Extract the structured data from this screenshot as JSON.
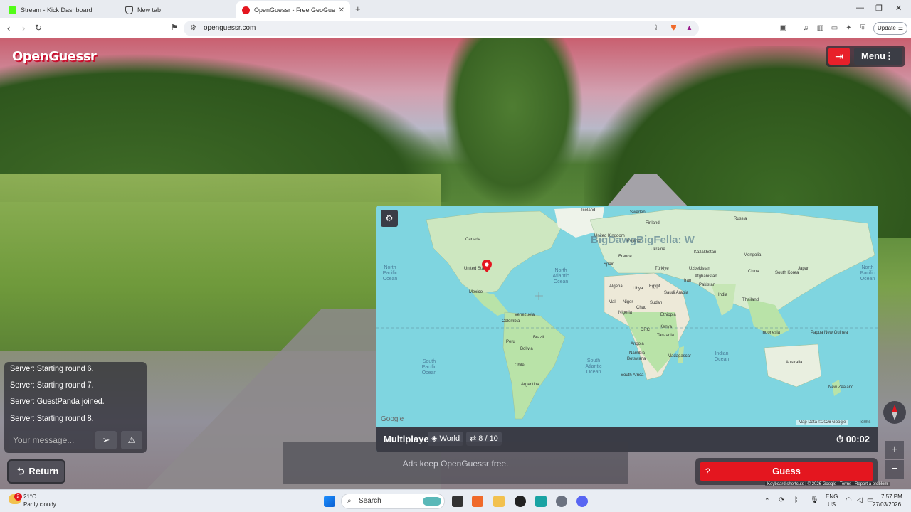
{
  "browser": {
    "tabs": [
      {
        "label": "Stream - Kick Dashboard",
        "icon": "kick-icon",
        "active": false
      },
      {
        "label": "New tab",
        "icon": "brave-shield-icon",
        "active": false
      },
      {
        "label": "OpenGuessr - Free GeoGuess",
        "icon": "openguessr-icon",
        "active": true
      }
    ],
    "url": "openguessr.com",
    "update_label": "Update"
  },
  "game": {
    "logo": "OpenGuessr",
    "menu_label": "Menu",
    "chat": {
      "messages": [
        "Server: Starting round 6.",
        "Server: Starting round 7.",
        "Server: GuestPanda joined.",
        "Server: Starting round 8."
      ],
      "input_placeholder": "Your message..."
    },
    "return_label": "Return",
    "map": {
      "player_label": "BigDawgBigFella: W",
      "countries": [
        "Iceland",
        "Sweden",
        "Finland",
        "Russia",
        "Canada",
        "United Kingdom",
        "Poland",
        "Ukraine",
        "Kazakhstan",
        "Mongolia",
        "France",
        "Spain",
        "Türkiye",
        "Uzbekistan",
        "United States",
        "Iran",
        "Afghanistan",
        "China",
        "South Korea",
        "Japan",
        "Pakistan",
        "Mexico",
        "Algeria",
        "Libya",
        "Egypt",
        "Saudi Arabia",
        "India",
        "Thailand",
        "Mali",
        "Niger",
        "Chad",
        "Sudan",
        "Venezuela",
        "Colombia",
        "Nigeria",
        "Ethiopia",
        "Peru",
        "Brazil",
        "DRC",
        "Kenya",
        "Tanzania",
        "Indonesia",
        "Papua New Guinea",
        "Bolivia",
        "Angola",
        "Madagascar",
        "Namibia",
        "Botswana",
        "Australia",
        "Chile",
        "South Africa",
        "Argentina",
        "New Zealand"
      ],
      "oceans": [
        "North Atlantic Ocean",
        "North Pacific Ocean",
        "North Pacific Ocean",
        "South Atlantic Ocean",
        "South Pacific Ocean",
        "Indian Ocean"
      ],
      "google": "Google",
      "attribution": "Map Data ©2026 Google",
      "terms": "Terms"
    },
    "bar": {
      "mode": "Multiplayer",
      "region": "World",
      "round": "8 / 10",
      "timer": "00:02"
    },
    "ad_text": "Ads keep OpenGuessr free.",
    "guess_label": "Guess",
    "guess_hint": "?",
    "sv_footer": "Keyboard shortcuts | © 2026 Google | Terms | Report a problem"
  },
  "taskbar": {
    "weather_temp": "21°C",
    "weather_desc": "Partly cloudy",
    "weather_badge": "2",
    "search_label": "Search",
    "lang_top": "ENG",
    "lang_bottom": "US",
    "time": "7:57 PM",
    "date": "27/03/2026"
  },
  "colors": {
    "accent_red": "#e4161f",
    "panel_dark": "#3a3c46",
    "ocean": "#7fd5e0",
    "land": "#b9e3a8"
  }
}
